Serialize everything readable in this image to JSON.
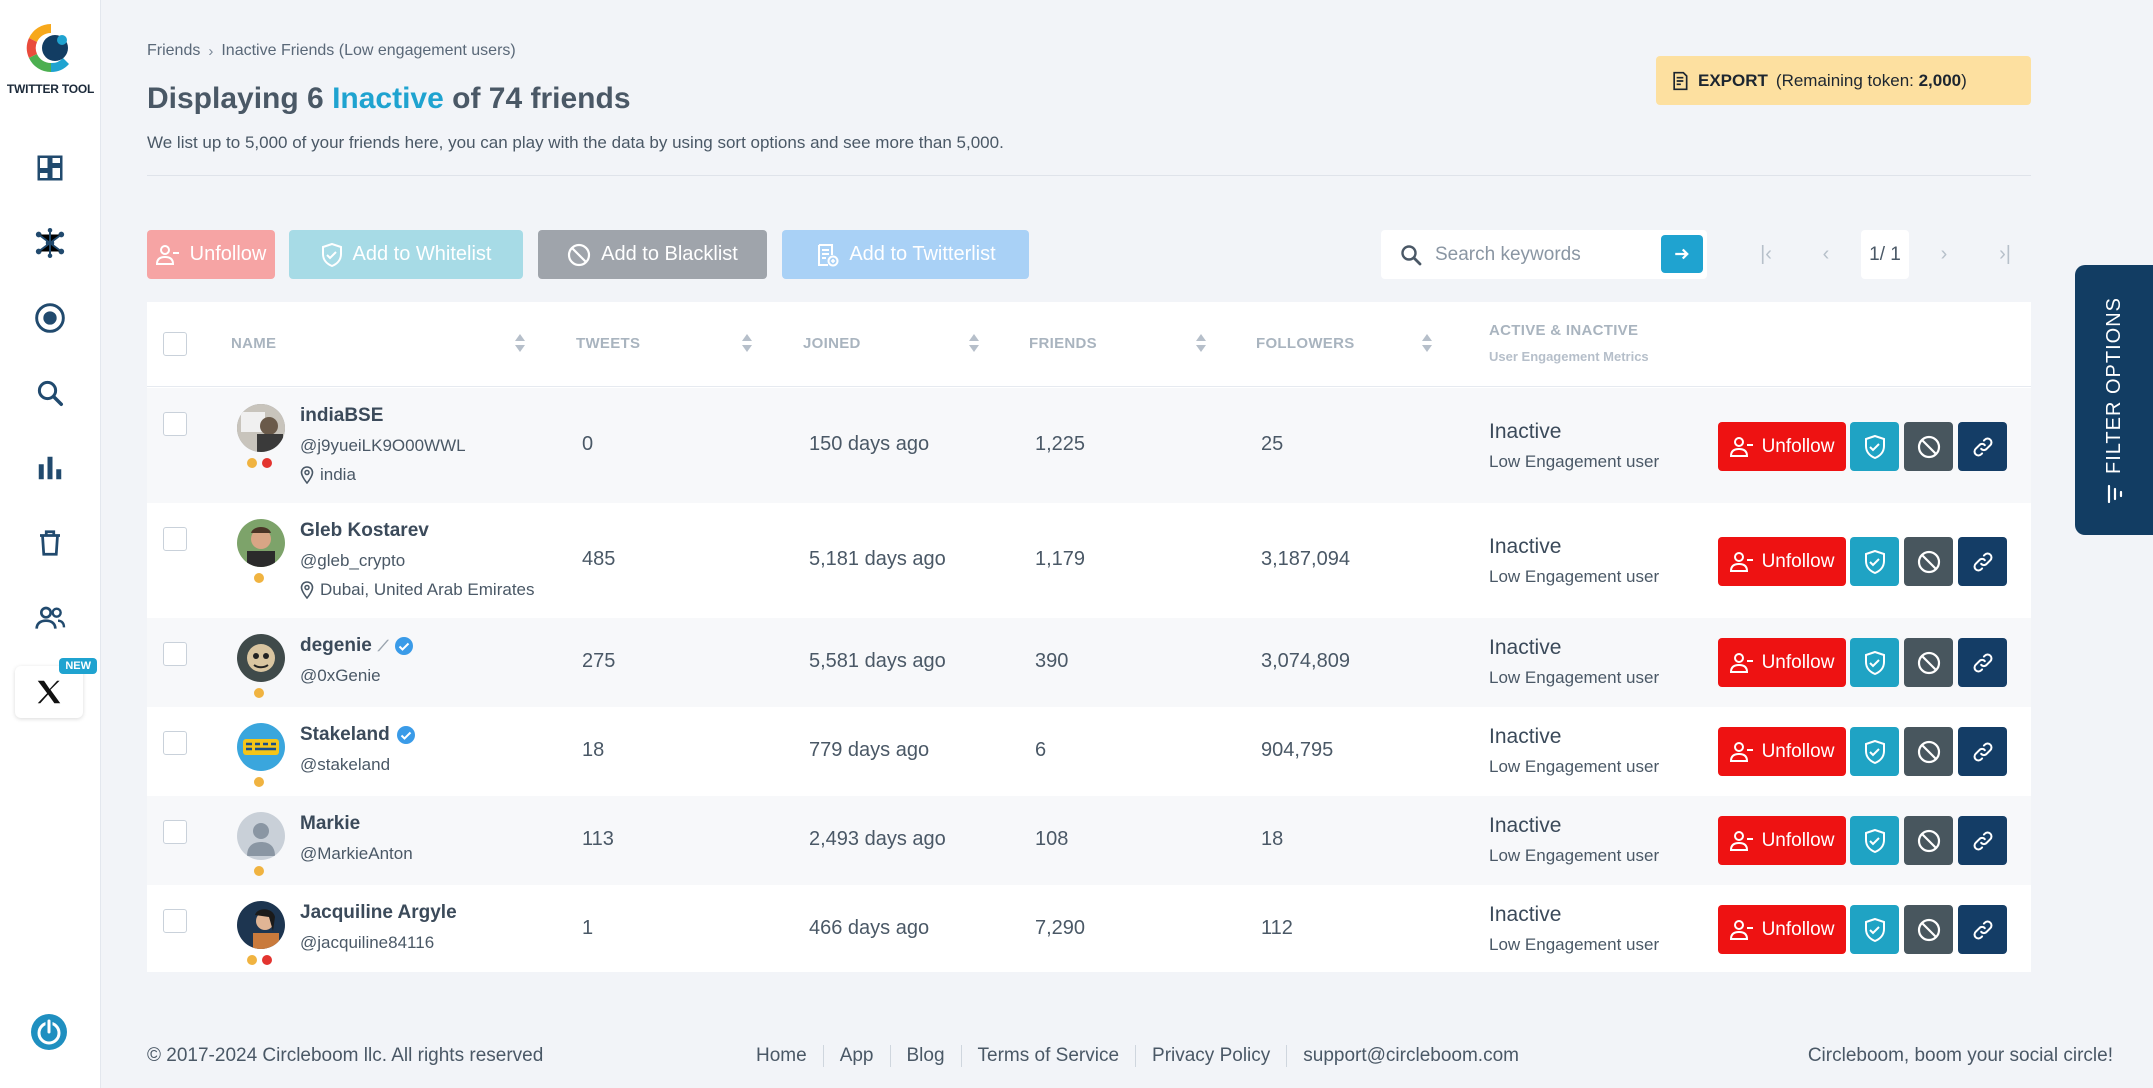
{
  "app": {
    "name": "TWITTER TOOL",
    "new_badge": "NEW"
  },
  "breadcrumb": {
    "parent": "Friends",
    "current": "Inactive Friends (Low engagement users)"
  },
  "title": {
    "prefix": "Displaying 6 ",
    "accent": "Inactive",
    "suffix": " of 74 friends"
  },
  "subtitle": "We list up to 5,000 of your friends here, you can play with the data by using sort options and see more than 5,000.",
  "export": {
    "label": "EXPORT",
    "remaining_prefix": "(Remaining token: ",
    "tokens": "2,000",
    "remaining_suffix": ")"
  },
  "toolbar": {
    "unfollow": "Unfollow",
    "whitelist": "Add to Whitelist",
    "blacklist": "Add to Blacklist",
    "twitterlist": "Add to Twitterlist"
  },
  "search": {
    "placeholder": "Search keywords"
  },
  "pagination": {
    "current": "1/ 1"
  },
  "table": {
    "headers": {
      "name": "NAME",
      "tweets": "TWEETS",
      "joined": "JOINED",
      "friends": "FRIENDS",
      "followers": "FOLLOWERS",
      "status": "ACTIVE & INACTIVE",
      "status_sub": "User Engagement Metrics"
    },
    "action_label": "Unfollow",
    "rows": [
      {
        "name": "indiaBSE",
        "handle": "@j9yueiLK9O00WWL",
        "location": "india",
        "tweets": "0",
        "joined": "150 days ago",
        "friends": "1,225",
        "followers": "25",
        "status": "Inactive",
        "status_sub": "Low Engagement user"
      },
      {
        "name": "Gleb Kostarev",
        "handle": "@gleb_crypto",
        "location": "Dubai, United Arab Emirates",
        "tweets": "485",
        "joined": "5,181 days ago",
        "friends": "1,179",
        "followers": "3,187,094",
        "status": "Inactive",
        "status_sub": "Low Engagement user"
      },
      {
        "name": "degenie",
        "handle": "@0xGenie",
        "location": "",
        "tweets": "275",
        "joined": "5,581 days ago",
        "friends": "390",
        "followers": "3,074,809",
        "status": "Inactive",
        "status_sub": "Low Engagement user"
      },
      {
        "name": "Stakeland",
        "handle": "@stakeland",
        "location": "",
        "tweets": "18",
        "joined": "779 days ago",
        "friends": "6",
        "followers": "904,795",
        "status": "Inactive",
        "status_sub": "Low Engagement user"
      },
      {
        "name": "Markie",
        "handle": "@MarkieAnton",
        "location": "",
        "tweets": "113",
        "joined": "2,493 days ago",
        "friends": "108",
        "followers": "18",
        "status": "Inactive",
        "status_sub": "Low Engagement user"
      },
      {
        "name": "Jacquiline Argyle",
        "handle": "@jacquiline84116",
        "location": "",
        "tweets": "1",
        "joined": "466 days ago",
        "friends": "7,290",
        "followers": "112",
        "status": "Inactive",
        "status_sub": "Low Engagement user"
      }
    ]
  },
  "filter": {
    "label": "FILTER OPTIONS"
  },
  "footer": {
    "copyright": "© 2017-2024 Circleboom llc. All rights reserved",
    "links": [
      "Home",
      "App",
      "Blog",
      "Terms of Service",
      "Privacy Policy",
      "support@circleboom.com"
    ],
    "tagline": "Circleboom, boom your social circle!"
  },
  "colors": {
    "accent": "#1fa3d0",
    "unfollow": "#ee1212",
    "navy": "#143d66",
    "export_bg": "#fde0a0"
  }
}
